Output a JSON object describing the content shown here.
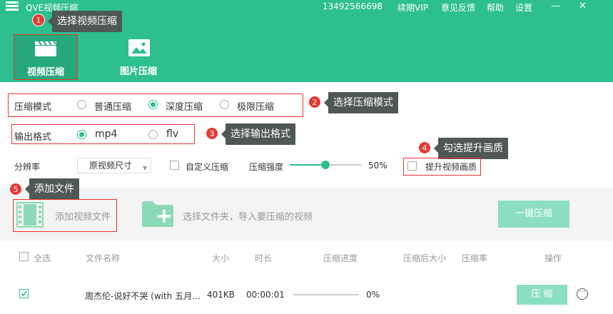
{
  "titlebar": {
    "app_title": "QVE视频压缩",
    "phone": "13492566698",
    "renew_vip": "续期VIP",
    "feedback": "意见反馈",
    "help": "帮助",
    "settings": "设置",
    "minimize": "—",
    "close": "✕"
  },
  "main_tabs": [
    {
      "label": "视频压缩",
      "icon": "clapperboard-icon",
      "active": true
    },
    {
      "label": "图片压缩",
      "icon": "image-icon",
      "active": false
    }
  ],
  "compress_mode": {
    "label": "压缩模式",
    "options": [
      "普通压缩",
      "深度压缩",
      "极限压缩"
    ],
    "selected": "深度压缩"
  },
  "output_format": {
    "label": "输出格式",
    "options": [
      "mp4",
      "flv"
    ],
    "selected": "mp4"
  },
  "settings_row": {
    "resolution_label": "分辨率",
    "resolution_value": "原视频尺寸",
    "custom_compress_label": "自定义压缩",
    "strength_label": "压缩强度",
    "strength_value": "50%",
    "strength_fraction": 0.5,
    "enhance_label": "提升视频画质"
  },
  "file_area": {
    "add_video": "添加视频文件",
    "choose_folder": "选择文件夹，导入要压缩的视频",
    "one_click": "一键压缩"
  },
  "table": {
    "headers": [
      "全选",
      "文件名称",
      "大小",
      "时长",
      "压缩进度",
      "压缩后大小",
      "压缩率",
      "操作"
    ],
    "rows": [
      {
        "checked": true,
        "name": "周杰伦-说好不哭 (with 五月…",
        "size": "401KB",
        "duration": "00:00:01",
        "progress": "0%",
        "progress_fraction": 0,
        "action": "压 缩"
      }
    ]
  },
  "callouts": [
    {
      "num": "1",
      "text": "选择视频压缩"
    },
    {
      "num": "2",
      "text": "选择压缩模式"
    },
    {
      "num": "3",
      "text": "选择输出格式"
    },
    {
      "num": "4",
      "text": "勾选提升画质"
    },
    {
      "num": "5",
      "text": "添加文件"
    }
  ],
  "colors": {
    "brand": "#2dbf8f",
    "brand_light": "#8cdec2",
    "callout_bg": "#4f5757",
    "badge": "#e53935",
    "highlight_box": "#e33333"
  }
}
